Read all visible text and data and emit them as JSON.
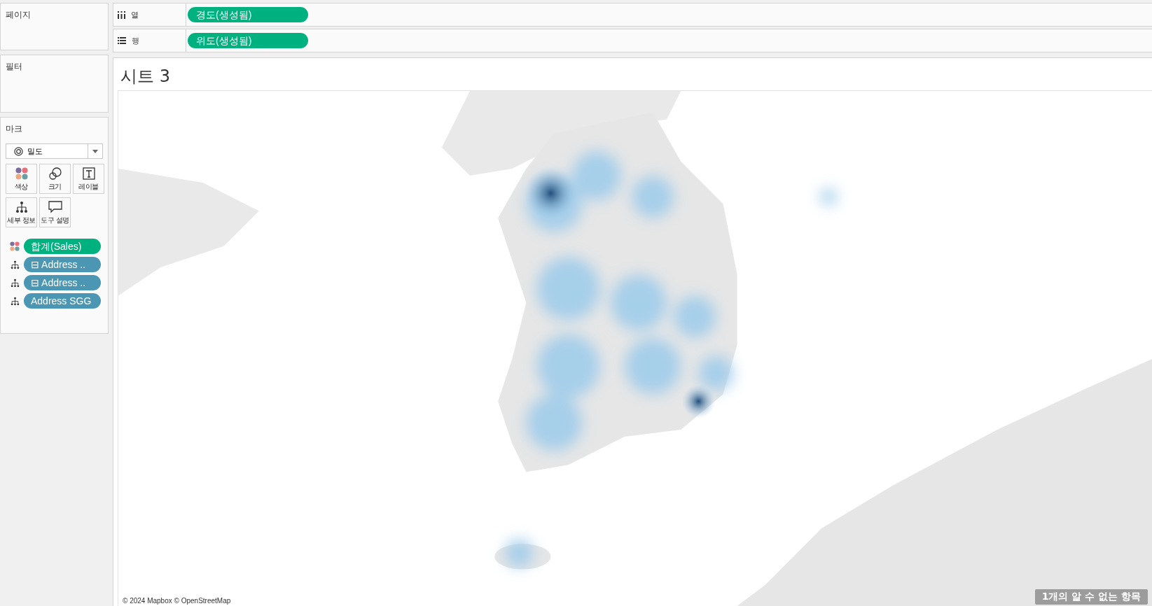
{
  "pages_card": {
    "title": "페이지"
  },
  "shelves": [
    {
      "kind": "columns",
      "label": "열",
      "pill": "경도(생성됨)"
    },
    {
      "kind": "rows",
      "label": "행",
      "pill": "위도(생성됨)"
    }
  ],
  "filters_card": {
    "title": "필터"
  },
  "marks_card": {
    "title": "마크",
    "mark_type": "밀도",
    "properties": [
      {
        "kind": "color",
        "label": "색상"
      },
      {
        "kind": "size",
        "label": "크기"
      },
      {
        "kind": "text",
        "label": "레이블"
      },
      {
        "kind": "detail",
        "label": "세부 정보"
      },
      {
        "kind": "tooltip",
        "label": "도구 설명"
      }
    ],
    "fields": [
      {
        "kind": "measure",
        "encoding": {
          "kind": "color"
        },
        "label": "합계(Sales)"
      },
      {
        "kind": "dimension",
        "encoding": {
          "kind": "detail"
        },
        "label": "⊟ Address .."
      },
      {
        "kind": "dimension",
        "encoding": {
          "kind": "detail"
        },
        "label": "⊟ Address .."
      },
      {
        "kind": "dimension",
        "encoding": {
          "kind": "detail"
        },
        "label": "Address SGG"
      }
    ]
  },
  "sheet": {
    "title": "시트 3",
    "map": {
      "kind": "picture",
      "attribution": "© 2024 Mapbox © OpenStreetMap",
      "unknown_badge": "1개의 알 수 없는 항목"
    }
  }
}
